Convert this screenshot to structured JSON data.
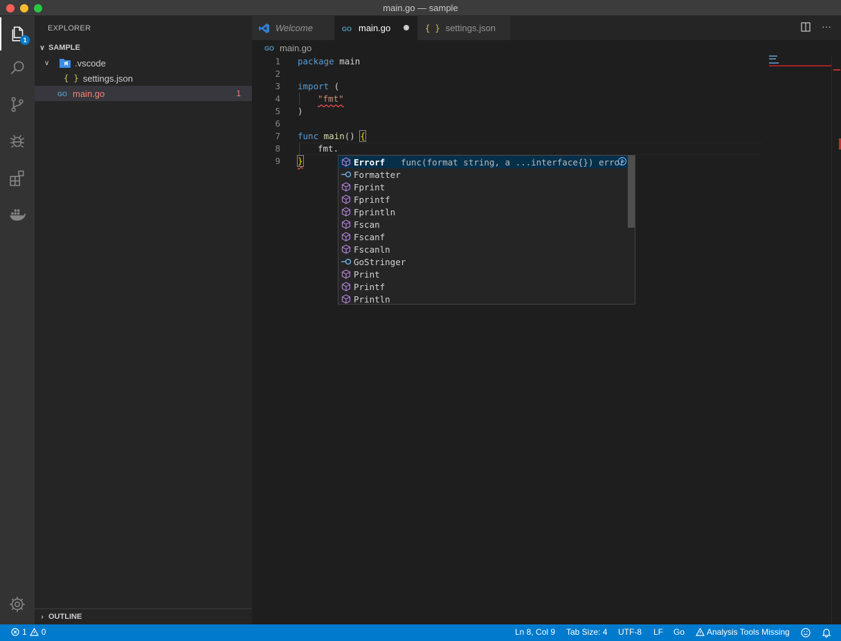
{
  "window": {
    "title": "main.go — sample"
  },
  "activity": {
    "explorer_badge": "1"
  },
  "sidebar": {
    "title": "EXPLORER",
    "section": "SAMPLE",
    "tree": [
      {
        "label": ".vscode",
        "type": "folder"
      },
      {
        "label": "settings.json",
        "type": "json"
      },
      {
        "label": "main.go",
        "type": "go",
        "errors": "1"
      }
    ],
    "outline": "OUTLINE"
  },
  "tabs": [
    {
      "label": "Welcome"
    },
    {
      "label": "main.go"
    },
    {
      "label": "settings.json"
    }
  ],
  "breadcrumb": {
    "file": "main.go"
  },
  "editor": {
    "line_numbers": [
      "1",
      "2",
      "3",
      "4",
      "5",
      "6",
      "7",
      "8",
      "9"
    ],
    "lines": {
      "l1_kw": "package",
      "l1_rest": " main",
      "l3_kw": "import",
      "l3_rest": " (",
      "l4_str": "\"fmt\"",
      "l5": ")",
      "l7_kw": "func",
      "l7_fn": " main",
      "l7_rest": "() ",
      "l7_brace": "{",
      "l8": "fmt.",
      "l9": "}"
    }
  },
  "suggest": {
    "items": [
      {
        "label": "Errorf",
        "kind": "function",
        "detail": "func(format string, a ...interface{}) error"
      },
      {
        "label": "Formatter",
        "kind": "interface"
      },
      {
        "label": "Fprint",
        "kind": "function"
      },
      {
        "label": "Fprintf",
        "kind": "function"
      },
      {
        "label": "Fprintln",
        "kind": "function"
      },
      {
        "label": "Fscan",
        "kind": "function"
      },
      {
        "label": "Fscanf",
        "kind": "function"
      },
      {
        "label": "Fscanln",
        "kind": "function"
      },
      {
        "label": "GoStringer",
        "kind": "interface"
      },
      {
        "label": "Print",
        "kind": "function"
      },
      {
        "label": "Printf",
        "kind": "function"
      },
      {
        "label": "Println",
        "kind": "function"
      }
    ]
  },
  "status": {
    "errors": "1",
    "warnings": "0",
    "position": "Ln 8, Col 9",
    "tab_size": "Tab Size: 4",
    "encoding": "UTF-8",
    "eol": "LF",
    "language": "Go",
    "analysis": "Analysis Tools Missing"
  },
  "colors": {
    "accent": "#007acc",
    "error": "#f48771",
    "go_icon": "#519aba"
  }
}
